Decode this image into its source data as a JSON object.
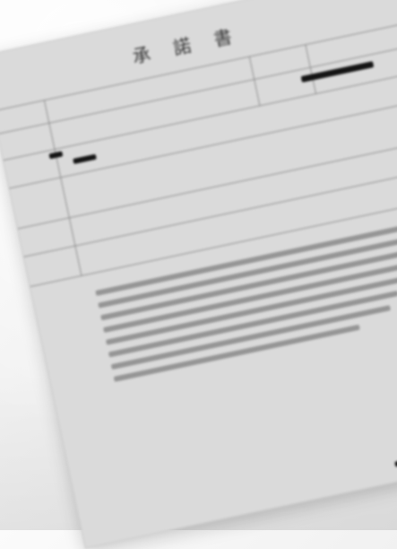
{
  "document": {
    "title": "承 諾 書",
    "table": {
      "row1": {
        "left_label": "",
        "right_label": "",
        "right_label2": ""
      },
      "row2": {
        "left_label": "",
        "center_label": "",
        "right_label": ""
      },
      "row3": {
        "left_label": ""
      },
      "row4": {
        "left_label": "",
        "right_label": ""
      },
      "row5": {
        "left_label": ""
      },
      "row6": {
        "left_label": ""
      }
    },
    "signature_block": {
      "line1_label": "",
      "line2_label": "",
      "line3_label": ""
    }
  }
}
